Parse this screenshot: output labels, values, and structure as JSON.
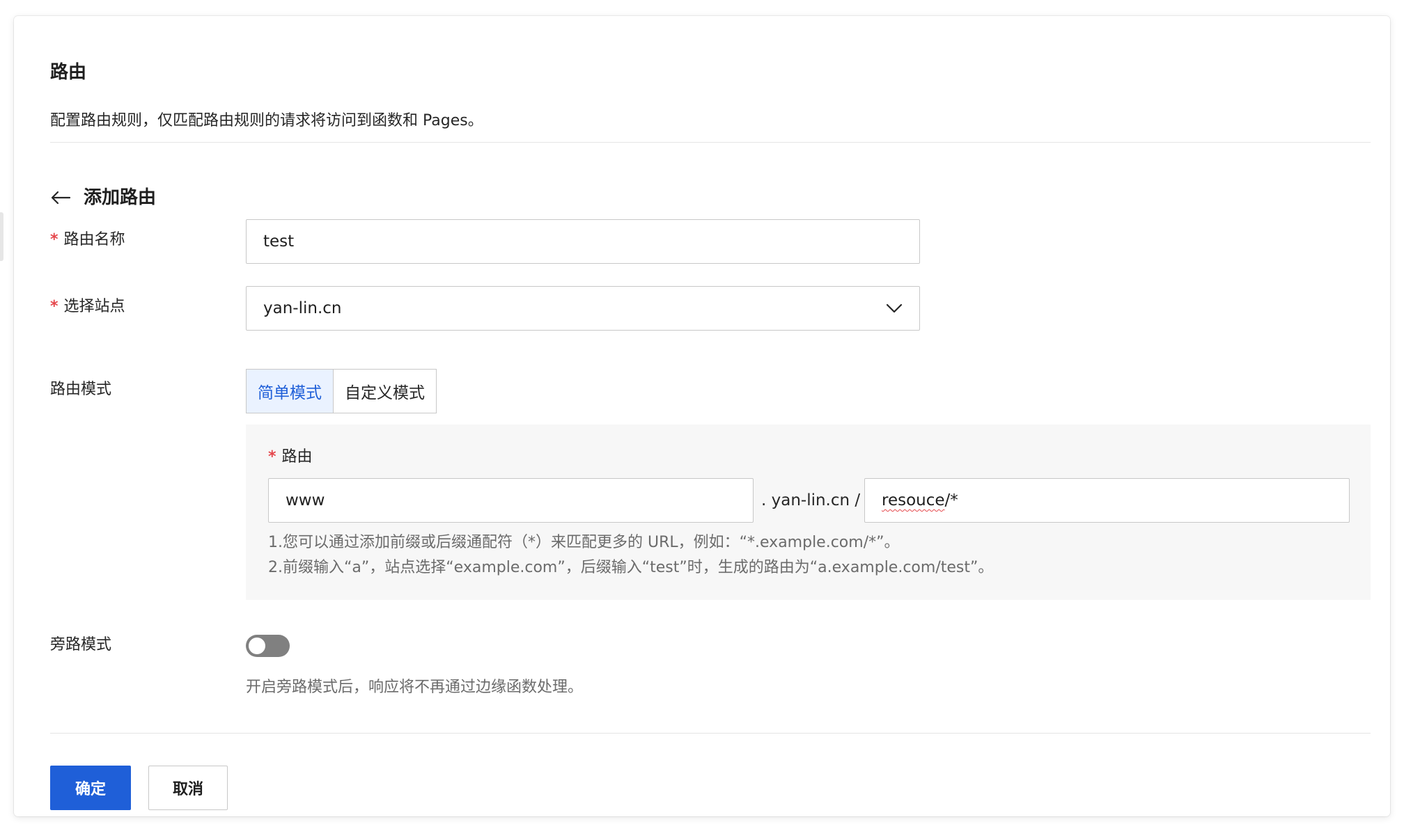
{
  "header": {
    "title": "路由",
    "description": "配置路由规则，仅匹配路由规则的请求将访问到函数和 Pages。"
  },
  "back": {
    "label": "添加路由"
  },
  "form": {
    "route_name": {
      "label": "路由名称",
      "value": "test"
    },
    "site": {
      "label": "选择站点",
      "value": "yan-lin.cn"
    },
    "route_mode": {
      "label": "路由模式",
      "options": [
        "简单模式",
        "自定义模式"
      ],
      "selected": "简单模式"
    },
    "route": {
      "label": "路由",
      "prefix": "www",
      "domain_text": ". yan-lin.cn /",
      "suffix_main": "resouce",
      "suffix_tail": "/*",
      "hints": [
        "1.您可以通过添加前缀或后缀通配符（*）来匹配更多的 URL，例如：“*.example.com/*”。",
        "2.前缀输入“a”，站点选择“example.com”，后缀输入“test”时，生成的路由为“a.example.com/test”。"
      ]
    },
    "bypass": {
      "label": "旁路模式",
      "enabled": false,
      "hint": "开启旁路模式后，响应将不再通过边缘函数处理。"
    }
  },
  "actions": {
    "confirm": "确定",
    "cancel": "取消"
  },
  "icons": {
    "back": "arrow-left-icon",
    "dropdown": "chevron-down-icon"
  },
  "colors": {
    "primary": "#1f5fd8",
    "required": "#e5484d",
    "toggle_off": "#808080"
  }
}
